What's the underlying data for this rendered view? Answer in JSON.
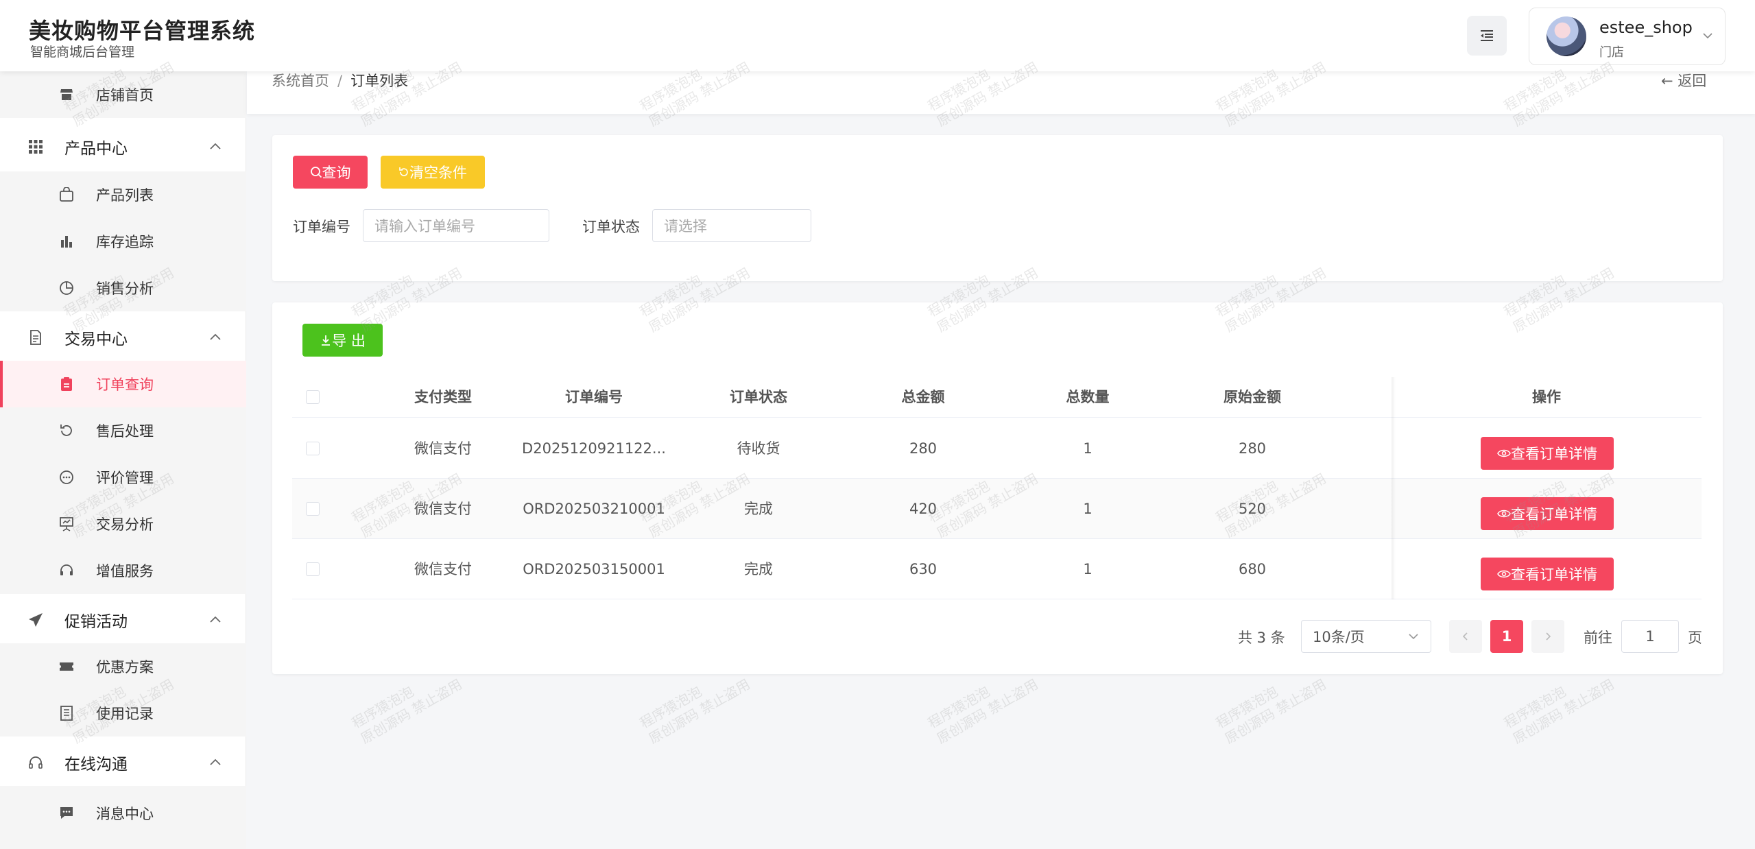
{
  "header": {
    "title": "美妆购物平台管理系统",
    "subtitle": "智能商城后台管理",
    "user_name": "estee_shop",
    "user_role": "门店"
  },
  "sidebar": {
    "items": [
      {
        "label": "店铺首页",
        "icon": "shop-icon"
      },
      {
        "label": "产品中心",
        "icon": "grid-icon"
      },
      {
        "label": "产品列表",
        "icon": "bag-icon"
      },
      {
        "label": "库存追踪",
        "icon": "bar-chart-icon"
      },
      {
        "label": "销售分析",
        "icon": "pie-chart-icon"
      },
      {
        "label": "交易中心",
        "icon": "document-icon"
      },
      {
        "label": "订单查询",
        "icon": "clipboard-icon"
      },
      {
        "label": "售后处理",
        "icon": "refresh-icon"
      },
      {
        "label": "评价管理",
        "icon": "chat-icon"
      },
      {
        "label": "交易分析",
        "icon": "presentation-icon"
      },
      {
        "label": "增值服务",
        "icon": "headset-icon"
      },
      {
        "label": "促销活动",
        "icon": "send-icon"
      },
      {
        "label": "优惠方案",
        "icon": "ticket-icon"
      },
      {
        "label": "使用记录",
        "icon": "notebook-icon"
      },
      {
        "label": "在线沟通",
        "icon": "headphones-icon"
      },
      {
        "label": "消息中心",
        "icon": "message-icon"
      }
    ]
  },
  "breadcrumb": {
    "home": "系统首页",
    "separator": "/",
    "current": "订单列表",
    "back": "返回"
  },
  "search": {
    "query_button": "查询",
    "clear_button": "清空条件",
    "order_no_label": "订单编号",
    "order_no_placeholder": "请输入订单编号",
    "status_label": "订单状态",
    "status_placeholder": "请选择"
  },
  "table": {
    "export_button": "导 出",
    "columns": [
      "支付类型",
      "订单编号",
      "订单状态",
      "总金额",
      "总数量",
      "原始金额",
      "操作"
    ],
    "rows": [
      {
        "pay_type": "微信支付",
        "order_no": "D2025120921122...",
        "status": "待收货",
        "total": "280",
        "qty": "1",
        "original": "280",
        "action": "查看订单详情"
      },
      {
        "pay_type": "微信支付",
        "order_no": "ORD202503210001",
        "status": "完成",
        "total": "420",
        "qty": "1",
        "original": "520",
        "action": "查看订单详情"
      },
      {
        "pay_type": "微信支付",
        "order_no": "ORD202503150001",
        "status": "完成",
        "total": "630",
        "qty": "1",
        "original": "680",
        "action": "查看订单详情"
      }
    ]
  },
  "pagination": {
    "total_text": "共 3 条",
    "page_size": "10条/页",
    "current_page": "1",
    "goto_label": "前往",
    "goto_value": "1",
    "goto_unit": "页"
  },
  "watermark": {
    "line1": "程序猿泡泡",
    "line2": "原创源码 禁止盗用"
  },
  "colors": {
    "primary": "#f5475f",
    "warning": "#f9c928",
    "success": "#4cc21d"
  }
}
